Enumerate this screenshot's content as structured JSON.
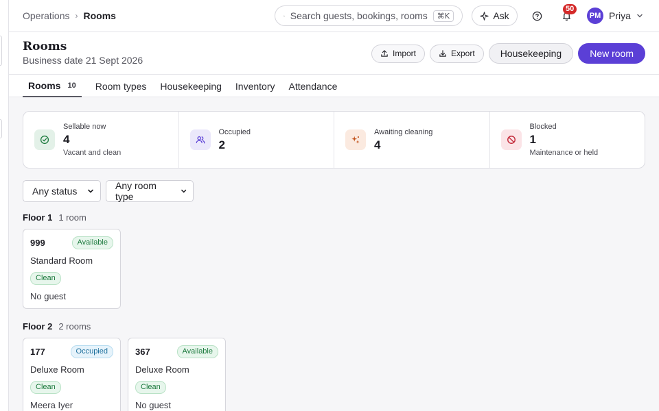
{
  "breadcrumb": {
    "parent": "Operations",
    "current": "Rooms"
  },
  "search": {
    "placeholder": "Search guests, bookings, rooms",
    "shortcut": "⌘K"
  },
  "topbar": {
    "ask_label": "Ask",
    "notification_count": "50"
  },
  "user": {
    "initials": "PM",
    "name": "Priya"
  },
  "page": {
    "title": "Rooms",
    "subtitle": "Business date 21 Sept 2026"
  },
  "actions": {
    "import": "Import",
    "export": "Export",
    "housekeeping": "Housekeeping",
    "new_room": "New room"
  },
  "tabs": [
    {
      "label": "Rooms",
      "count": "10"
    },
    {
      "label": "Room types"
    },
    {
      "label": "Housekeeping"
    },
    {
      "label": "Inventory"
    },
    {
      "label": "Attendance"
    }
  ],
  "stats": [
    {
      "label": "Sellable now",
      "value": "4",
      "note": "Vacant and clean",
      "icon": "check-circle-icon",
      "color": "#1d7a3e",
      "bg": "#e3f1e8"
    },
    {
      "label": "Occupied",
      "value": "2",
      "note": "",
      "icon": "users-icon",
      "color": "#5b3fd6",
      "bg": "#ebe8fb"
    },
    {
      "label": "Awaiting cleaning",
      "value": "4",
      "note": "",
      "icon": "sparkle-icon",
      "color": "#c2521b",
      "bg": "#fbeae0"
    },
    {
      "label": "Blocked",
      "value": "1",
      "note": "Maintenance or held",
      "icon": "ban-icon",
      "color": "#c42c3c",
      "bg": "#fbe4e7"
    }
  ],
  "filters": {
    "status": "Any status",
    "room_type": "Any room type"
  },
  "floors": [
    {
      "title": "Floor 1",
      "count": "1 room",
      "rooms": [
        {
          "number": "999",
          "status": "Available",
          "type": "Standard Room",
          "clean": "Clean",
          "guest": "No guest"
        }
      ]
    },
    {
      "title": "Floor 2",
      "count": "2 rooms",
      "rooms": [
        {
          "number": "177",
          "status": "Occupied",
          "type": "Deluxe Room",
          "clean": "Clean",
          "guest": "Meera Iyer"
        },
        {
          "number": "367",
          "status": "Available",
          "type": "Deluxe Room",
          "clean": "Clean",
          "guest": "No guest"
        }
      ]
    }
  ]
}
